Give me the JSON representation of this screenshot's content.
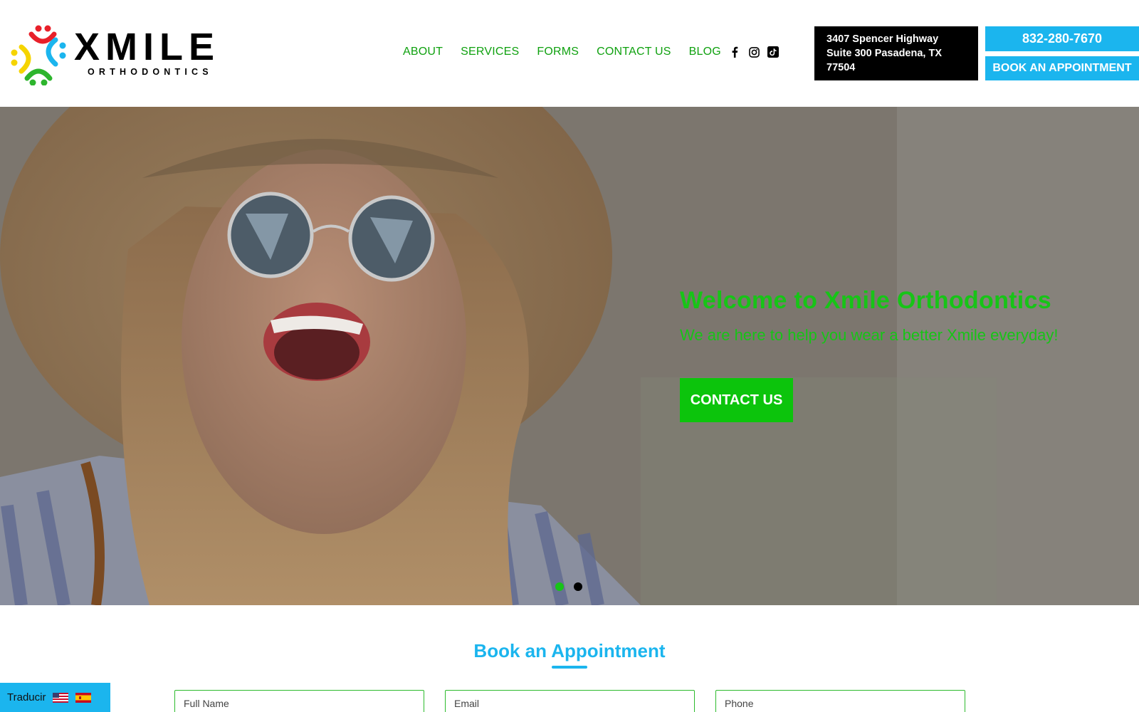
{
  "brand": {
    "name": "XMILE",
    "tagline": "ORTHODONTICS",
    "colors": {
      "green": "#17c417",
      "blue": "#1bb5ee",
      "red": "#e8202a",
      "yellow": "#f5d400"
    }
  },
  "nav": {
    "items": [
      {
        "label": "ABOUT"
      },
      {
        "label": "SERVICES"
      },
      {
        "label": "FORMS"
      },
      {
        "label": "CONTACT US"
      },
      {
        "label": "BLOG"
      }
    ]
  },
  "social": {
    "icons": [
      "facebook-icon",
      "instagram-icon",
      "tiktok-icon"
    ]
  },
  "contact": {
    "address_line1": "3407 Spencer Highway",
    "address_line2": "Suite 300 Pasadena, TX",
    "address_line3": "77504",
    "phone": "832-280-7670",
    "book_label": "BOOK AN APPOINTMENT"
  },
  "hero": {
    "title": "Welcome to Xmile Orthodontics",
    "subtitle": "We are here to help you wear a better Xmile everyday!",
    "cta_label": "CONTACT US",
    "slides": 2,
    "active_slide": 1
  },
  "booking": {
    "title": "Book an Appointment",
    "fields": [
      {
        "placeholder": "Full Name"
      },
      {
        "placeholder": "Email"
      },
      {
        "placeholder": "Phone"
      }
    ]
  },
  "translate": {
    "label": "Traducir",
    "flags": [
      "us-flag-icon",
      "spain-flag-icon"
    ]
  }
}
